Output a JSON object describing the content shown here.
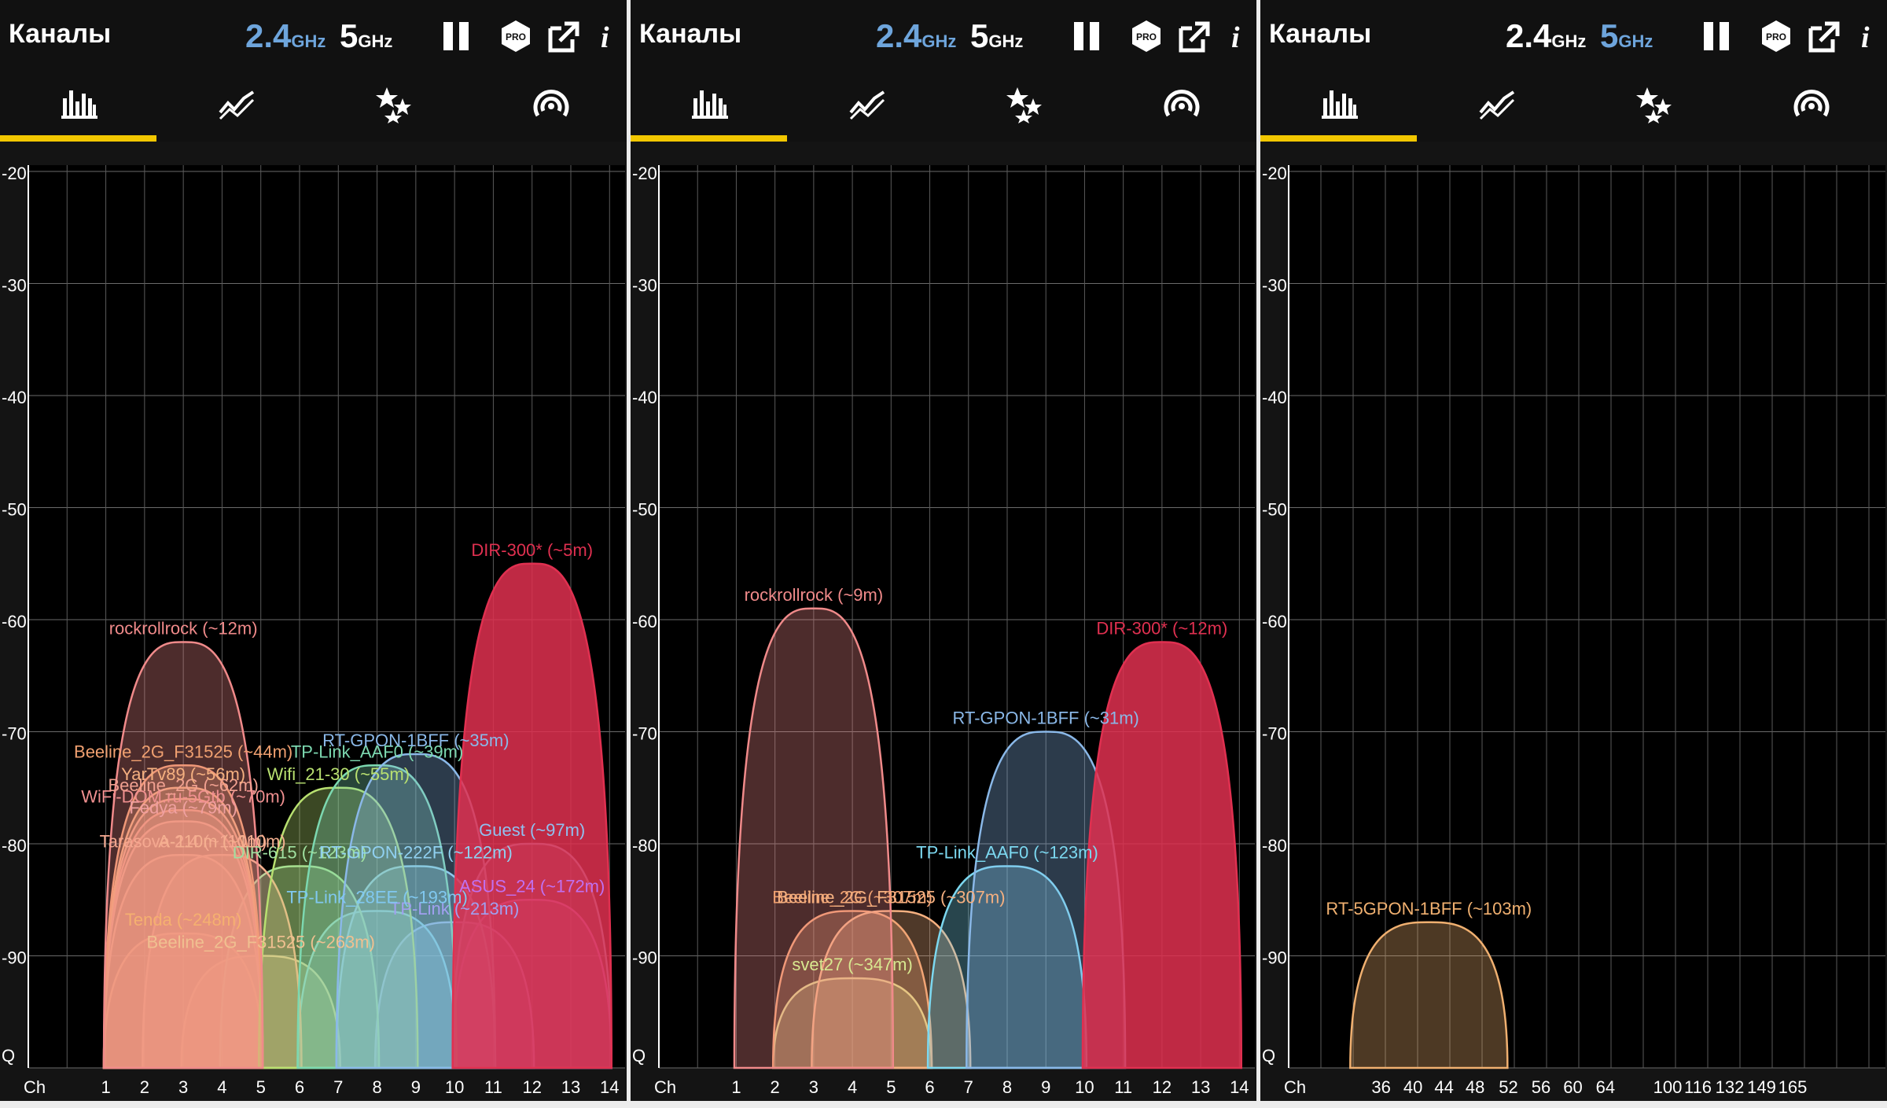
{
  "panels": [
    {
      "title": "Каналы",
      "band_24": {
        "value": "2.4",
        "unit": "GHz",
        "active": true
      },
      "band_5": {
        "value": "5",
        "unit": "GHz",
        "active": false
      },
      "icons": [
        "pause-icon",
        "pro-badge-icon",
        "export-icon",
        "info-icon"
      ],
      "pro_label": "PRO",
      "info_label": "i",
      "tabs": [
        "channel-graph-icon",
        "time-graph-icon",
        "channel-rating-icon",
        "signal-strength-icon"
      ],
      "active_tab": 0
    },
    {
      "title": "Каналы",
      "band_24": {
        "value": "2.4",
        "unit": "GHz",
        "active": true
      },
      "band_5": {
        "value": "5",
        "unit": "GHz",
        "active": false
      },
      "pro_label": "PRO",
      "info_label": "i",
      "active_tab": 0
    },
    {
      "title": "Каналы",
      "band_24": {
        "value": "2.4",
        "unit": "GHz",
        "active": false
      },
      "band_5": {
        "value": "5",
        "unit": "GHz",
        "active": true
      },
      "pro_label": "PRO",
      "info_label": "i",
      "active_tab": 0
    }
  ],
  "chart_data": [
    {
      "type": "area",
      "ylabel_ticks": [
        "-20",
        "-30",
        "-40",
        "-50",
        "-60",
        "-70",
        "-80",
        "-90",
        "Q"
      ],
      "ylim": [
        -100,
        -20
      ],
      "x_axis_label": "Ch",
      "x_ticks": [
        "1",
        "2",
        "3",
        "4",
        "5",
        "6",
        "7",
        "8",
        "9",
        "10",
        "11",
        "12",
        "13",
        "14"
      ],
      "series": [
        {
          "name": "rockrollrock (~12m)",
          "channel": 3,
          "dbm": -62,
          "color": "#f08a8a"
        },
        {
          "name": "Beeline_2G_F31525 (~44m)",
          "channel": 3,
          "dbm": -73,
          "color": "#f0a070"
        },
        {
          "name": "YarTv89 (~56m)",
          "channel": 3,
          "dbm": -75,
          "color": "#f5b080"
        },
        {
          "name": "Beeline_2G (~62m)",
          "channel": 3,
          "dbm": -76,
          "color": "#f0a090"
        },
        {
          "name": "WiFi-DOM.ru-5Gtb (~70m)",
          "channel": 3,
          "dbm": -77,
          "color": "#f09090"
        },
        {
          "name": "Fedya (~79m)",
          "channel": 3,
          "dbm": -78,
          "color": "#f0a0a0"
        },
        {
          "name": "Tarasova 2.4 (~110m)",
          "channel": 3,
          "dbm": -81,
          "color": "#f5a890"
        },
        {
          "name": "A-110m (~110m)",
          "channel": 4,
          "dbm": -81,
          "color": "#f5b090"
        },
        {
          "name": "Tenda (~248m)",
          "channel": 3,
          "dbm": -88,
          "color": "#f5b070"
        },
        {
          "name": "Beeline_2G_F31525 (~263m)",
          "channel": 5,
          "dbm": -90,
          "color": "#f0c090"
        },
        {
          "name": "Wifi_21-30 (~55m)",
          "channel": 7,
          "dbm": -75,
          "color": "#b8e070"
        },
        {
          "name": "DIR-615 (~123m)",
          "channel": 6,
          "dbm": -82,
          "color": "#a0e0a0"
        },
        {
          "name": "TP-Link_AAF0 (~39m)",
          "channel": 8,
          "dbm": -73,
          "color": "#7cd8b0"
        },
        {
          "name": "RT-GPON-1BFF (~35m)",
          "channel": 9,
          "dbm": -72,
          "color": "#8ab8e8"
        },
        {
          "name": "RT-GPON-222F (~122m)",
          "channel": 9,
          "dbm": -82,
          "color": "#90d0f0"
        },
        {
          "name": "TP-Link_28EE (~193m)",
          "channel": 8,
          "dbm": -86,
          "color": "#80c8f0"
        },
        {
          "name": "TP-Link (~213m)",
          "channel": 10,
          "dbm": -87,
          "color": "#a0a0f0"
        },
        {
          "name": "Guest (~97m)",
          "channel": 12,
          "dbm": -80,
          "color": "#90c0f0"
        },
        {
          "name": "ASUS_24 (~172m)",
          "channel": 12,
          "dbm": -85,
          "color": "#c070f0"
        },
        {
          "name": "DIR-300* (~5m)",
          "channel": 12,
          "dbm": -55,
          "color": "#e03050"
        }
      ]
    },
    {
      "type": "area",
      "ylabel_ticks": [
        "-20",
        "-30",
        "-40",
        "-50",
        "-60",
        "-70",
        "-80",
        "-90",
        "Q"
      ],
      "ylim": [
        -100,
        -20
      ],
      "x_axis_label": "Ch",
      "x_ticks": [
        "1",
        "2",
        "3",
        "4",
        "5",
        "6",
        "7",
        "8",
        "9",
        "10",
        "11",
        "12",
        "13",
        "14"
      ],
      "series": [
        {
          "name": "rockrollrock (~9m)",
          "channel": 3,
          "dbm": -59,
          "color": "#f08a8a"
        },
        {
          "name": "Beeline_2G (~307m)",
          "channel": 4,
          "dbm": -86,
          "color": "#f0a070"
        },
        {
          "name": "Beeline_2G_F31525 (~307m)",
          "channel": 5,
          "dbm": -86,
          "color": "#f5b080"
        },
        {
          "name": "svet27 (~347m)",
          "channel": 4,
          "dbm": -92,
          "color": "#d8e890"
        },
        {
          "name": "RT-GPON-1BFF (~31m)",
          "channel": 9,
          "dbm": -70,
          "color": "#8ab8e8"
        },
        {
          "name": "TP-Link_AAF0 (~123m)",
          "channel": 8,
          "dbm": -82,
          "color": "#7cd8f0"
        },
        {
          "name": "DIR-300* (~12m)",
          "channel": 12,
          "dbm": -62,
          "color": "#e03050"
        }
      ]
    },
    {
      "type": "area",
      "ylabel_ticks": [
        "-20",
        "-30",
        "-40",
        "-50",
        "-60",
        "-70",
        "-80",
        "-90",
        "Q"
      ],
      "ylim": [
        -100,
        -20
      ],
      "x_axis_label": "Ch",
      "x_ticks": [
        "36",
        "40",
        "44",
        "48",
        "52",
        "56",
        "60",
        "64",
        "100",
        "116",
        "132",
        "149",
        "165"
      ],
      "series": [
        {
          "name": "RT-5GPON-1BFF (~103m)",
          "channel": 42,
          "dbm": -87,
          "color": "#f0b070"
        }
      ]
    }
  ]
}
